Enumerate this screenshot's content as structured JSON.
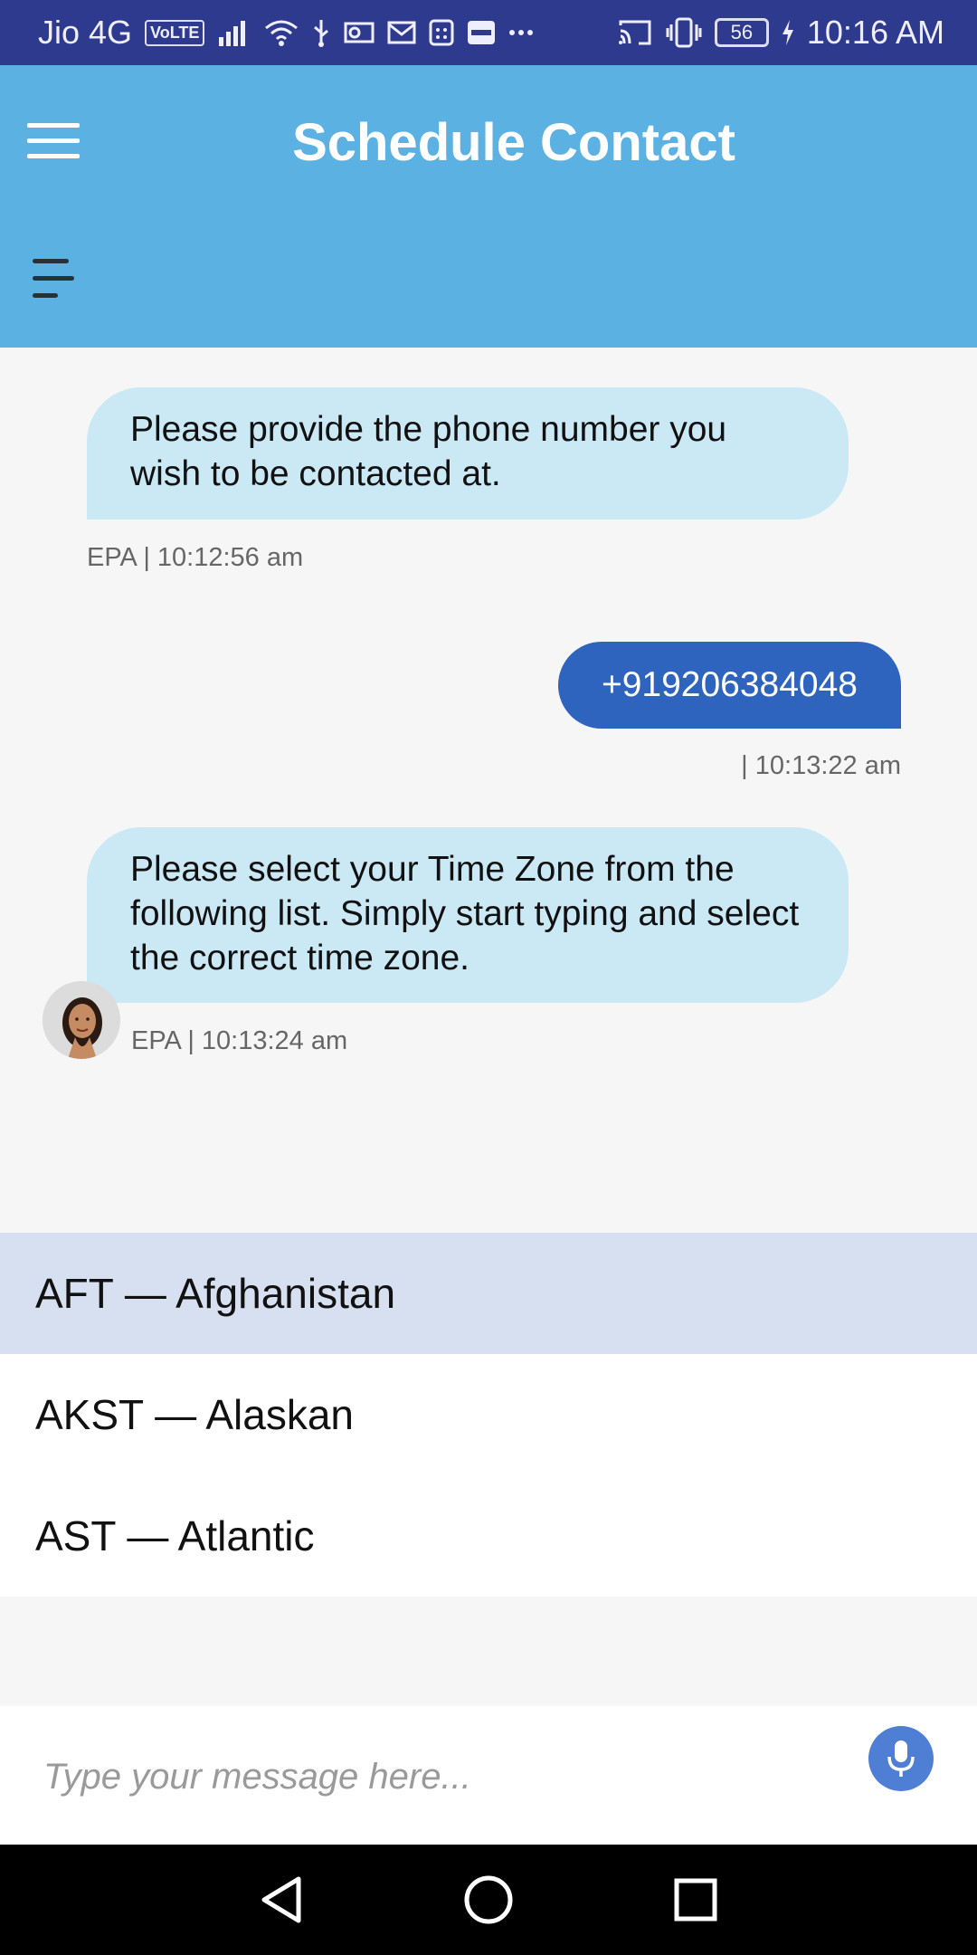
{
  "status_bar": {
    "carrier": "Jio 4G",
    "volte": "VoLTE",
    "battery": "56",
    "time": "10:16 AM"
  },
  "app_bar": {
    "title": "Schedule Contact"
  },
  "messages": [
    {
      "text": "Please provide the phone number you wish to be contacted at.",
      "meta": "EPA | 10:12:56 am"
    },
    {
      "text": "+919206384048",
      "meta": "| 10:13:22 am"
    },
    {
      "text": "Please select your Time Zone from the following list. Simply start typing and select the correct time zone.",
      "meta": "EPA | 10:13:24 am"
    }
  ],
  "suggestions": [
    {
      "label": "AFT — Afghanistan"
    },
    {
      "label": "AKST — Alaskan"
    },
    {
      "label": "AST — Atlantic"
    }
  ],
  "input": {
    "placeholder": "Type your message here..."
  },
  "colors": {
    "status_bar": "#2d3a8e",
    "app_bar": "#5cb1e3",
    "bot_bubble": "#cbe8f5",
    "user_bubble": "#2e64bd",
    "suggest_active": "#d6e0f1",
    "mic": "#4f7fd4"
  }
}
